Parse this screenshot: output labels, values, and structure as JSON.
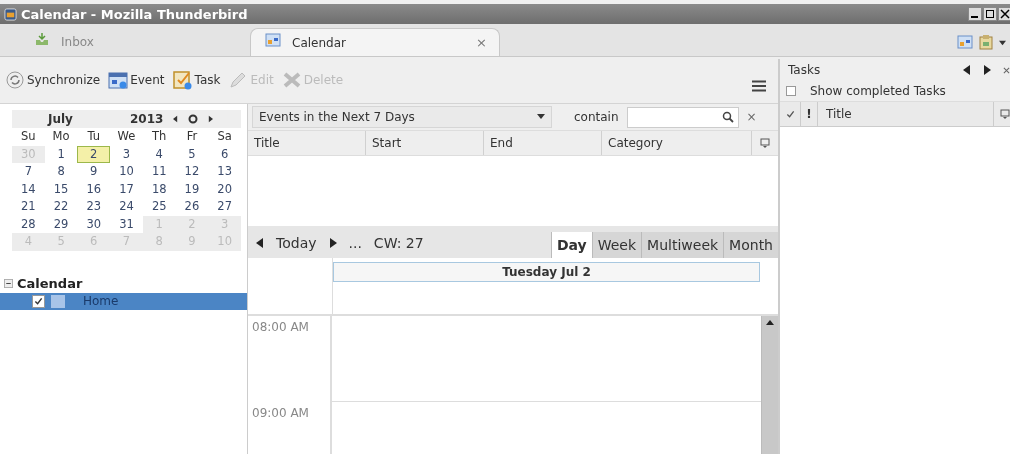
{
  "window": {
    "title": "Calendar - Mozilla Thunderbird"
  },
  "tabs": [
    {
      "label": "Inbox",
      "kind": "mail",
      "selected": false
    },
    {
      "label": "Calendar",
      "kind": "calendar",
      "selected": true,
      "close": "×"
    }
  ],
  "toolbar": [
    {
      "label": "Synchronize",
      "kind": "sync",
      "disabled": false
    },
    {
      "label": "Event",
      "kind": "event",
      "disabled": false
    },
    {
      "label": "Task",
      "kind": "task",
      "disabled": false
    },
    {
      "label": "Edit",
      "kind": "edit",
      "disabled": true
    },
    {
      "label": "Delete",
      "kind": "delete",
      "disabled": true
    }
  ],
  "minimonth": {
    "month": "July",
    "year": "2013",
    "weekdays": [
      "Su",
      "Mo",
      "Tu",
      "We",
      "Th",
      "Fr",
      "Sa"
    ],
    "weeks": [
      [
        {
          "day": "30",
          "other_month": true,
          "selected": false
        },
        {
          "day": "1",
          "other_month": false,
          "selected": false
        },
        {
          "day": "2",
          "other_month": false,
          "selected": true
        },
        {
          "day": "3",
          "other_month": false,
          "selected": false
        },
        {
          "day": "4",
          "other_month": false,
          "selected": false
        },
        {
          "day": "5",
          "other_month": false,
          "selected": false
        },
        {
          "day": "6",
          "other_month": false,
          "selected": false
        }
      ],
      [
        {
          "day": "7",
          "other_month": false,
          "selected": false
        },
        {
          "day": "8",
          "other_month": false,
          "selected": false
        },
        {
          "day": "9",
          "other_month": false,
          "selected": false
        },
        {
          "day": "10",
          "other_month": false,
          "selected": false
        },
        {
          "day": "11",
          "other_month": false,
          "selected": false
        },
        {
          "day": "12",
          "other_month": false,
          "selected": false
        },
        {
          "day": "13",
          "other_month": false,
          "selected": false
        }
      ],
      [
        {
          "day": "14",
          "other_month": false,
          "selected": false
        },
        {
          "day": "15",
          "other_month": false,
          "selected": false
        },
        {
          "day": "16",
          "other_month": false,
          "selected": false
        },
        {
          "day": "17",
          "other_month": false,
          "selected": false
        },
        {
          "day": "18",
          "other_month": false,
          "selected": false
        },
        {
          "day": "19",
          "other_month": false,
          "selected": false
        },
        {
          "day": "20",
          "other_month": false,
          "selected": false
        }
      ],
      [
        {
          "day": "21",
          "other_month": false,
          "selected": false
        },
        {
          "day": "22",
          "other_month": false,
          "selected": false
        },
        {
          "day": "23",
          "other_month": false,
          "selected": false
        },
        {
          "day": "24",
          "other_month": false,
          "selected": false
        },
        {
          "day": "25",
          "other_month": false,
          "selected": false
        },
        {
          "day": "26",
          "other_month": false,
          "selected": false
        },
        {
          "day": "27",
          "other_month": false,
          "selected": false
        }
      ],
      [
        {
          "day": "28",
          "other_month": false,
          "selected": false
        },
        {
          "day": "29",
          "other_month": false,
          "selected": false
        },
        {
          "day": "30",
          "other_month": false,
          "selected": false
        },
        {
          "day": "31",
          "other_month": false,
          "selected": false
        },
        {
          "day": "1",
          "other_month": true,
          "selected": false
        },
        {
          "day": "2",
          "other_month": true,
          "selected": false
        },
        {
          "day": "3",
          "other_month": true,
          "selected": false
        }
      ],
      [
        {
          "day": "4",
          "other_month": true,
          "selected": false
        },
        {
          "day": "5",
          "other_month": true,
          "selected": false
        },
        {
          "day": "6",
          "other_month": true,
          "selected": false
        },
        {
          "day": "7",
          "other_month": true,
          "selected": false
        },
        {
          "day": "8",
          "other_month": true,
          "selected": false
        },
        {
          "day": "9",
          "other_month": true,
          "selected": false
        },
        {
          "day": "10",
          "other_month": true,
          "selected": false
        }
      ]
    ]
  },
  "calendar_list": {
    "title": "Calendar",
    "expanded": true,
    "items": [
      {
        "name": "Home",
        "checked": true,
        "selected": true,
        "color": "#a8c4e8"
      }
    ]
  },
  "event_filter": {
    "range": "Events in the Next 7 Days",
    "contain_label": "contain",
    "close": "×"
  },
  "event_table": {
    "columns": [
      "Title",
      "Start",
      "End",
      "Category"
    ]
  },
  "nav": {
    "today": "Today",
    "ellipsis": "...",
    "week": "CW: 27"
  },
  "views": [
    {
      "label": "Day",
      "selected": true
    },
    {
      "label": "Week",
      "selected": false
    },
    {
      "label": "Multiweek",
      "selected": false
    },
    {
      "label": "Month",
      "selected": false
    }
  ],
  "day_view": {
    "header": "Tuesday Jul 2",
    "hours": [
      "08:00 AM",
      "09:00 AM"
    ]
  },
  "tasks_pane": {
    "title": "Tasks",
    "show_completed": {
      "label": "Show completed Tasks",
      "checked": false
    },
    "columns": [
      {
        "kind": "done"
      },
      {
        "kind": "priority",
        "label": "!"
      },
      {
        "kind": "title",
        "label": "Title"
      }
    ]
  }
}
